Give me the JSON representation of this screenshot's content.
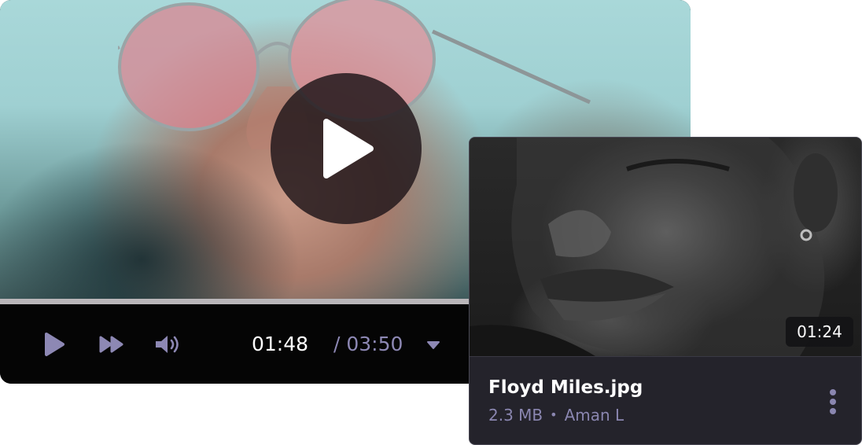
{
  "player": {
    "current_time": "01:48",
    "total_time": "/ 03:50",
    "progress_fraction": 1.0,
    "controls": {
      "play_icon": "play-icon",
      "fast_forward_icon": "fast-forward-icon",
      "volume_icon": "volume-icon",
      "dropdown_icon": "caret-down-icon"
    },
    "colors": {
      "time_current": "#ffffff",
      "time_total": "#8d88b4",
      "control_icons": "#8d88b4",
      "controls_bar": "#050505"
    }
  },
  "card": {
    "duration": "01:24",
    "file_name": "Floyd Miles.jpg",
    "file_size": "2.3 MB",
    "separator": "•",
    "owner": "Aman L",
    "more_icon": "more-vertical-icon",
    "colors": {
      "background": "#24232b",
      "meta_text": "#8a86b0"
    }
  }
}
